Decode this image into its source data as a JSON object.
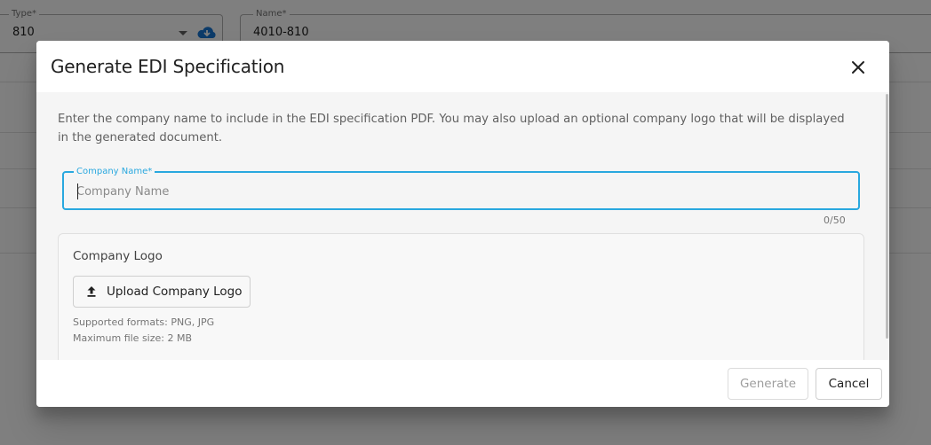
{
  "background": {
    "type_field": {
      "label": "Type*",
      "value": "810"
    },
    "name_field": {
      "label": "Name*",
      "value": "4010-810"
    }
  },
  "dialog": {
    "title": "Generate EDI Specification",
    "description": "Enter the company name to include in the EDI specification PDF. You may also upload an optional company logo that will be displayed in the generated document.",
    "company_name": {
      "label": "Company Name*",
      "placeholder": "Company Name",
      "value": "",
      "counter": "0/50"
    },
    "logo": {
      "title": "Company Logo",
      "upload_label": "Upload Company Logo",
      "formats": "Supported formats: PNG, JPG",
      "max_size": "Maximum file size: 2 MB"
    },
    "footer": {
      "generate_label": "Generate",
      "cancel_label": "Cancel"
    }
  },
  "colors": {
    "accent": "#29a8df",
    "overlay": "rgba(0,0,0,0.5)",
    "disabled_text": "#9e9e9e"
  },
  "icons": {
    "close": "close-icon",
    "upload": "upload-icon",
    "cloud": "cloud-download-icon",
    "dropdown": "chevron-down-icon"
  }
}
